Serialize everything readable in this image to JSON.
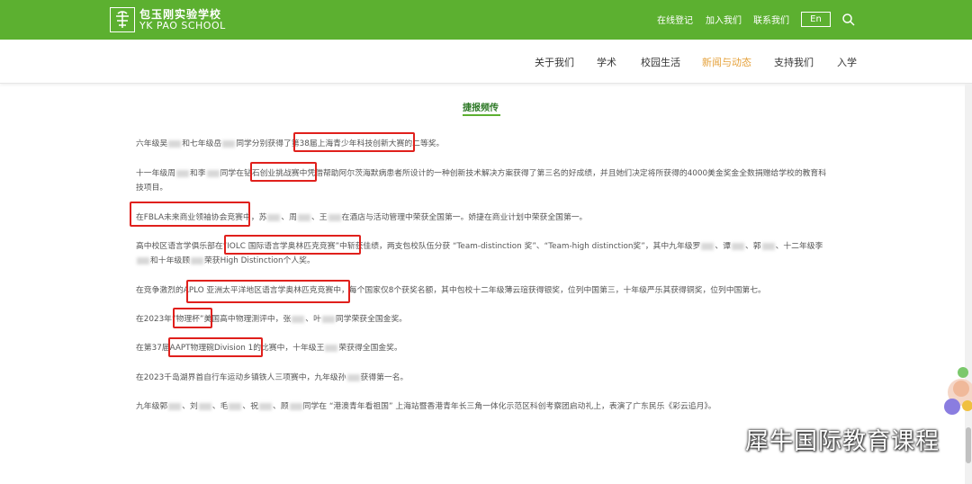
{
  "header": {
    "logo_cn": "包玉刚实验学校",
    "logo_en": "YK PAO SCHOOL",
    "links": [
      "在线登记",
      "加入我们",
      "联系我们"
    ],
    "lang_button": "En",
    "search_icon": "search-icon",
    "bg_color": "#5cb030"
  },
  "nav": {
    "items": [
      "关于我们",
      "学术",
      "校园生活",
      "新闻与动态",
      "支持我们",
      "入学"
    ],
    "active_color": "#e5a13b"
  },
  "section": {
    "title": "捷报频传"
  },
  "paras": {
    "p1": [
      "六年级吴",
      "和七年级岳",
      "同学分别获得了",
      "第38届上海青少年科技创新大赛",
      "的二等奖。"
    ],
    "p2": [
      "十一年级周",
      "和李",
      "同学在",
      "钻石创业挑战赛",
      "中凭借帮助阿尔茨海默病患者所设计的一种创新技术解决方案获得了第三名的好成绩，并且她们决定将所获得的4000美金奖金全数捐赠给学校的教育科技项目。"
    ],
    "p3": [
      "在FBLA未来商业领袖协会竞赛",
      "中，苏",
      "、周",
      "、王",
      "在酒店与活动管理中荣获全国第一。",
      "娇捷在商业计划中荣获全国第一。"
    ],
    "p4": [
      "高中校区语言学俱乐部在",
      "“IOLC 国际语言学奥林匹克竞赛”",
      "中斩获佳绩，两支包校队伍分获 “Team-distinction 奖”、“Team-high distinction奖”，其中九年级罗",
      "、谭",
      "、郭",
      "、十二年级李",
      "和十年级顾",
      "荣获High Distinction个人奖。"
    ],
    "p5": [
      "在竞争激烈的",
      "APLO 亚洲太平洋地区语言学奥林匹克竞赛",
      "中，每个国家仅8个获奖名额，其中包校十二年级薄云瑄获得银奖，位列中国第三，十年级严乐其获得铜奖，位列中国第七。"
    ],
    "p6": [
      "在2023年",
      "“物理杯”",
      "美国高中物理测评中，张",
      "、叶",
      "同学荣获全国金奖。"
    ],
    "p7": [
      "在第37届",
      "AAPT物理碗Division 1",
      "的比赛中，十年级王",
      "荣获得全国金奖。"
    ],
    "p8": [
      "在2023千岛湖界首自行车运动乡镇铁人三项赛中，九年级孙",
      "获得第一名。"
    ],
    "p9": [
      "九年级郭",
      "、刘",
      "、毛",
      "、祝",
      "、顾",
      "同学在 “港澳青年看祖国” 上海站暨香港青年长三角一体化示范区科创考察团启动礼上，表演了广东民乐《彩云追月》。"
    ]
  },
  "highlight_color": "#e0201c",
  "watermark": {
    "text": "犀牛国际教育课程",
    "icon": "wechat-icon"
  }
}
